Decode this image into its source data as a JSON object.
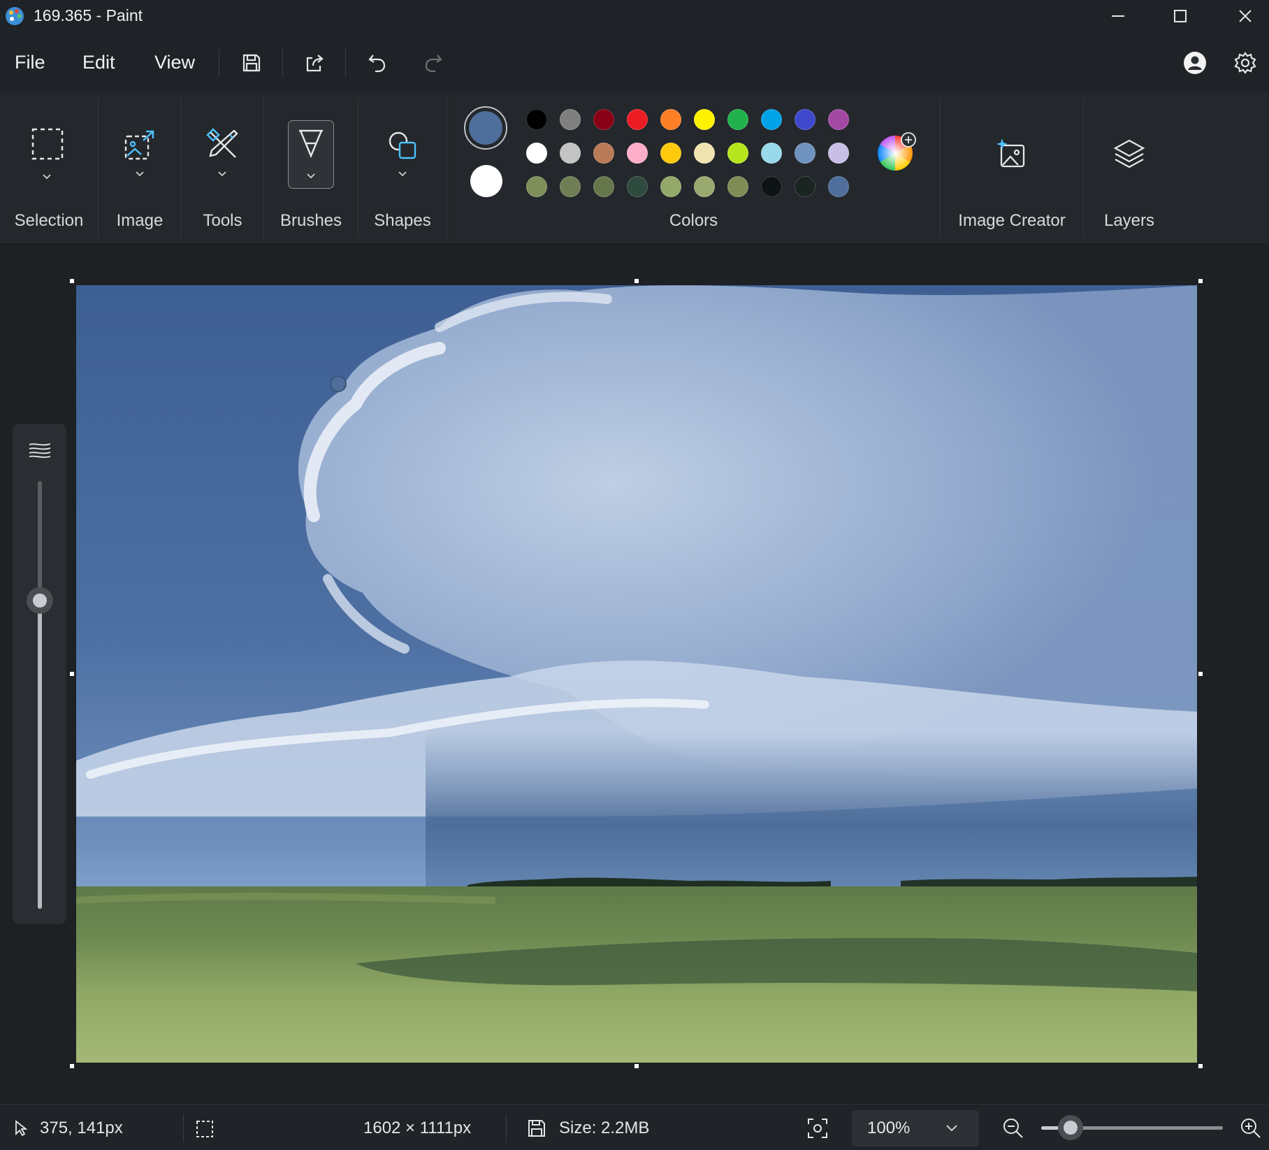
{
  "window": {
    "title": "169.365 - Paint",
    "icons": {
      "app": "paint-palette-icon",
      "minimize": "minimize-icon",
      "maximize": "maximize-icon",
      "close": "close-icon"
    }
  },
  "menu": {
    "file": "File",
    "edit": "Edit",
    "view": "View",
    "quick_actions": [
      "save-icon",
      "share-icon",
      "undo-icon",
      "redo-icon"
    ],
    "right_icons": [
      "account-icon",
      "settings-icon"
    ]
  },
  "ribbon": {
    "groups": {
      "selection": "Selection",
      "image": "Image",
      "tools": "Tools",
      "brushes": "Brushes",
      "shapes": "Shapes",
      "colors": "Colors",
      "image_creator": "Image Creator",
      "layers": "Layers"
    },
    "colors": {
      "primary": "#4f6e9b",
      "secondary": "#ffffff",
      "palette": [
        [
          "#000000",
          "#7f7f7f",
          "#880015",
          "#ed1c24",
          "#ff7f27",
          "#fff200",
          "#22b14c",
          "#00a2e8",
          "#3f48cc",
          "#a349a4"
        ],
        [
          "#ffffff",
          "#c3c3c3",
          "#b97a57",
          "#ffaec9",
          "#ffc90e",
          "#efe4b0",
          "#b5e61d",
          "#99d9ea",
          "#7092be",
          "#c8bfe7"
        ],
        [
          "#7e8f5a",
          "#6f7e55",
          "#66774c",
          "#2f4a3e",
          "#93a86a",
          "#9aa970",
          "#7f8c55",
          "#0e1416",
          "#1a2420",
          "#4f6e9b"
        ]
      ],
      "edit_colors_icon": "color-wheel-add-icon"
    }
  },
  "canvas": {
    "brush_size_icon": "brush-size-icon",
    "brush_size_level": 0.72
  },
  "status": {
    "cursor_position": "375, 141px",
    "canvas_size": "1602 × 1111px",
    "file_size": "Size: 2.2MB",
    "zoom": "100%",
    "zoom_level": 0.16,
    "icons": [
      "pointer-icon",
      "selection-size-icon",
      "disk-icon",
      "fit-to-window-icon",
      "zoom-out-icon",
      "zoom-in-icon"
    ]
  }
}
